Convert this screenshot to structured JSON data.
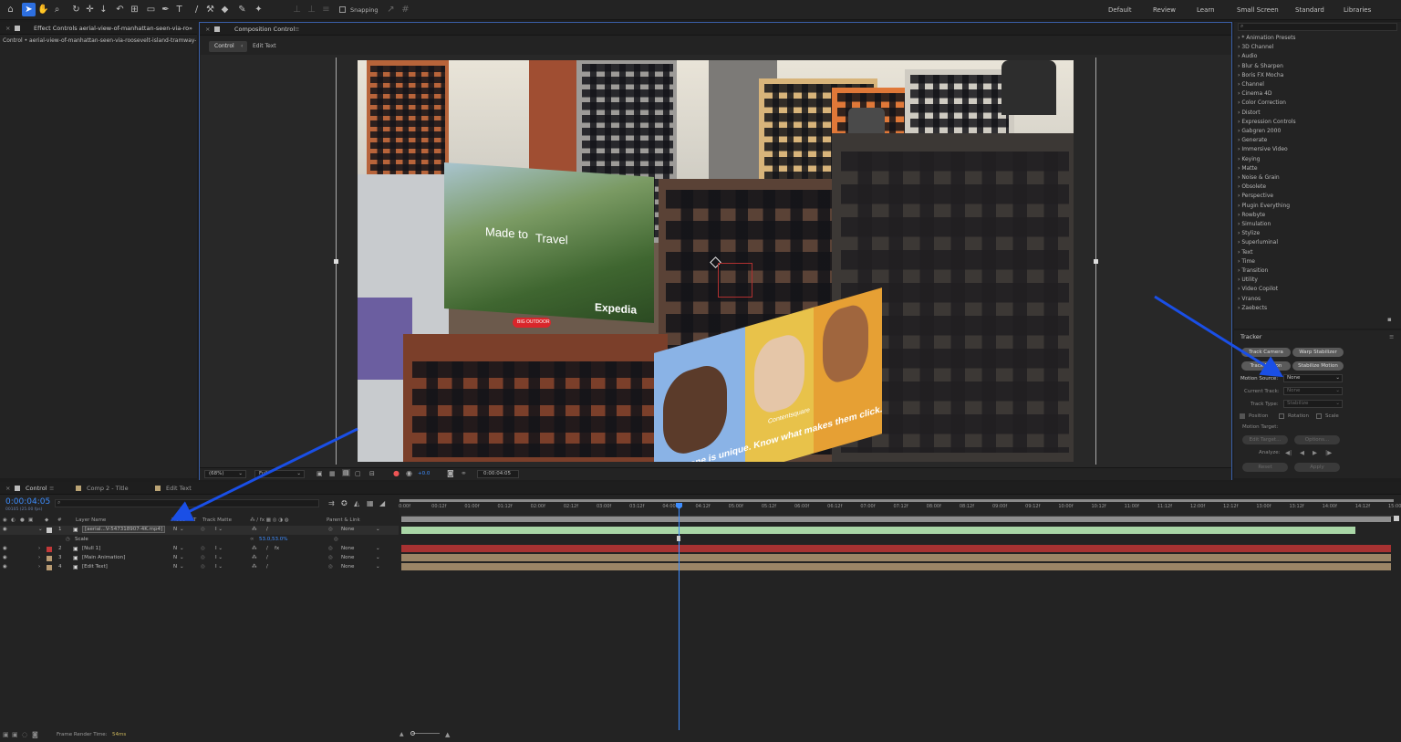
{
  "toolbar": {
    "snapping_label": "Snapping",
    "workspaces": [
      "Default",
      "Review",
      "Learn",
      "Small Screen",
      "Standard",
      "Libraries"
    ]
  },
  "effect_controls": {
    "tab_label": "Effect Controls aerial-view-of-manhattan-seen-via-roosev",
    "path": "Control • aerial-view-of-manhattan-seen-via-roosevelt-island-tramway-o"
  },
  "composition": {
    "tab_label": "Composition Control",
    "subtabs": [
      "Control",
      "Edit Text"
    ]
  },
  "viewer_footer": {
    "zoom": "(68%)",
    "resolution": "Full",
    "exposure": "+0.0",
    "timecode": "0:00:04:05"
  },
  "frame_art": {
    "billboard1_text": "Made to",
    "billboard1_text2": "Travel",
    "billboard1_brand": "Expedia",
    "billboard1_sign": "BIG OUTDOOR",
    "billboard2_text": "Everyone is unique. Know what makes them click.",
    "billboard2_brand": "Contentsquare"
  },
  "effects_presets": {
    "items": [
      "* Animation Presets",
      "3D Channel",
      "Audio",
      "Blur & Sharpen",
      "Boris FX Mocha",
      "Channel",
      "Cinema 4D",
      "Color Correction",
      "Distort",
      "Expression Controls",
      "Gabgren 2000",
      "Generate",
      "Immersive Video",
      "Keying",
      "Matte",
      "Noise & Grain",
      "Obsolete",
      "Perspective",
      "Plugin Everything",
      "Rowbyte",
      "Simulation",
      "Stylize",
      "Superluminal",
      "Text",
      "Time",
      "Transition",
      "Utility",
      "Video Copilot",
      "Vranos",
      "Zaebects"
    ]
  },
  "tracker": {
    "title": "Tracker",
    "buttons": [
      "Track Camera",
      "Warp Stabilizer",
      "Track Motion",
      "Stabilize Motion"
    ],
    "motion_source_label": "Motion Source:",
    "motion_source_value": "None",
    "current_track_label": "Current Track:",
    "current_track_value": "None",
    "track_type_label": "Track Type:",
    "track_type_value": "Stabilize",
    "position_label": "Position",
    "rotation_label": "Rotation",
    "scale_label": "Scale",
    "motion_target_label": "Motion Target:",
    "edit_target_label": "Edit Target...",
    "options_label": "Options...",
    "analyze_label": "Analyze:",
    "reset_label": "Reset",
    "apply_label": "Apply"
  },
  "timeline": {
    "tabs": [
      "Control",
      "Comp 2 - Title",
      "Edit Text"
    ],
    "current_time": "0:00:04:05",
    "fps_info": "00105 (25.00 fps)",
    "headers": {
      "layer_name": "Layer Name",
      "mode": "Mode",
      "t": "T",
      "track_matte": "Track Matte",
      "parent": "Parent & Link"
    },
    "layers": [
      {
        "num": "1",
        "name": "[aerial...V-547318907-4K.mp4]",
        "mode": "N",
        "parent": "None",
        "color": "#c8c8c8"
      },
      {
        "num": "2",
        "name": "[Null 1]",
        "mode": "N",
        "parent": "None",
        "color": "#c23838"
      },
      {
        "num": "3",
        "name": "[Main Animation]",
        "mode": "N",
        "parent": "None",
        "color": "#b89a72"
      },
      {
        "num": "4",
        "name": "[Edit Text]",
        "mode": "N",
        "parent": "None",
        "color": "#b89a72"
      }
    ],
    "scale_prop": {
      "label": "Scale",
      "value": "53.0,53.0%"
    },
    "ruler": [
      "0:00f",
      "00:12f",
      "01:00f",
      "01:12f",
      "02:00f",
      "02:12f",
      "03:00f",
      "03:12f",
      "04:00f",
      "04:12f",
      "05:00f",
      "05:12f",
      "06:00f",
      "06:12f",
      "07:00f",
      "07:12f",
      "08:00f",
      "08:12f",
      "09:00f",
      "09:12f",
      "10:00f",
      "10:12f",
      "11:00f",
      "11:12f",
      "12:00f",
      "12:12f",
      "13:00f",
      "13:12f",
      "14:00f",
      "14:12f",
      "15:00"
    ],
    "render_time_label": "Frame Render Time:",
    "render_time_value": "54ms"
  },
  "colors": {
    "accent": "#2d6fe0",
    "arrow": "#1a4fe6",
    "green_bar": "#a9d6a6",
    "red_bar": "#a73232",
    "tan_bar": "#9b8566"
  }
}
